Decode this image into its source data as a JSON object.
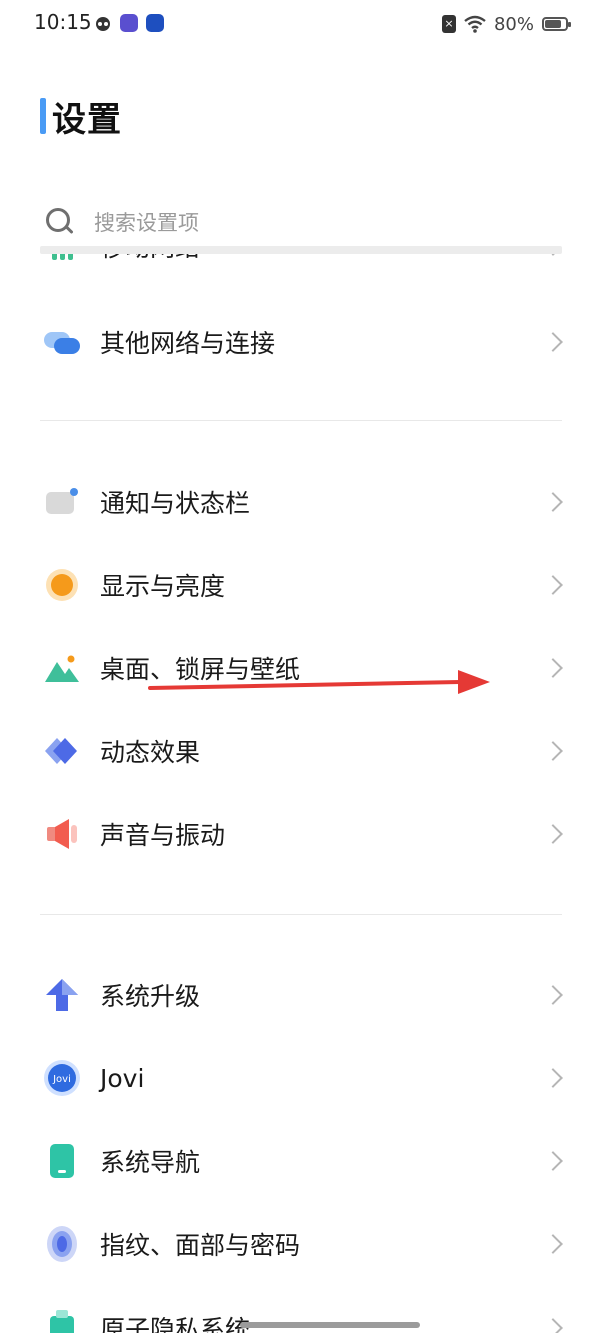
{
  "status_bar": {
    "time": "10:15",
    "battery": "80%",
    "battery_level": 0.8,
    "sim_icon_text": "×"
  },
  "page": {
    "title": "设置"
  },
  "search": {
    "placeholder": "搜索设置项"
  },
  "partial_top_label": "移动网络",
  "rows": [
    {
      "label": "其他网络与连接",
      "icon": "network-connections-icon"
    },
    {
      "label": "通知与状态栏",
      "icon": "notification-icon"
    },
    {
      "label": "显示与亮度",
      "icon": "display-brightness-icon"
    },
    {
      "label": "桌面、锁屏与壁纸",
      "icon": "wallpaper-icon"
    },
    {
      "label": "动态效果",
      "icon": "animation-icon"
    },
    {
      "label": "声音与振动",
      "icon": "sound-icon"
    },
    {
      "label": "系统升级",
      "icon": "system-upgrade-icon"
    },
    {
      "label": "Jovi",
      "icon": "jovi-icon"
    },
    {
      "label": "系统导航",
      "icon": "system-navigation-icon"
    },
    {
      "label": "指纹、面部与密码",
      "icon": "fingerprint-icon"
    }
  ],
  "partial_bottom_label": "原子隐私系统",
  "jovi_icon_text": "Jovi",
  "colors": {
    "accent": "#4a9bf5",
    "annotation_arrow": "#e53935"
  }
}
